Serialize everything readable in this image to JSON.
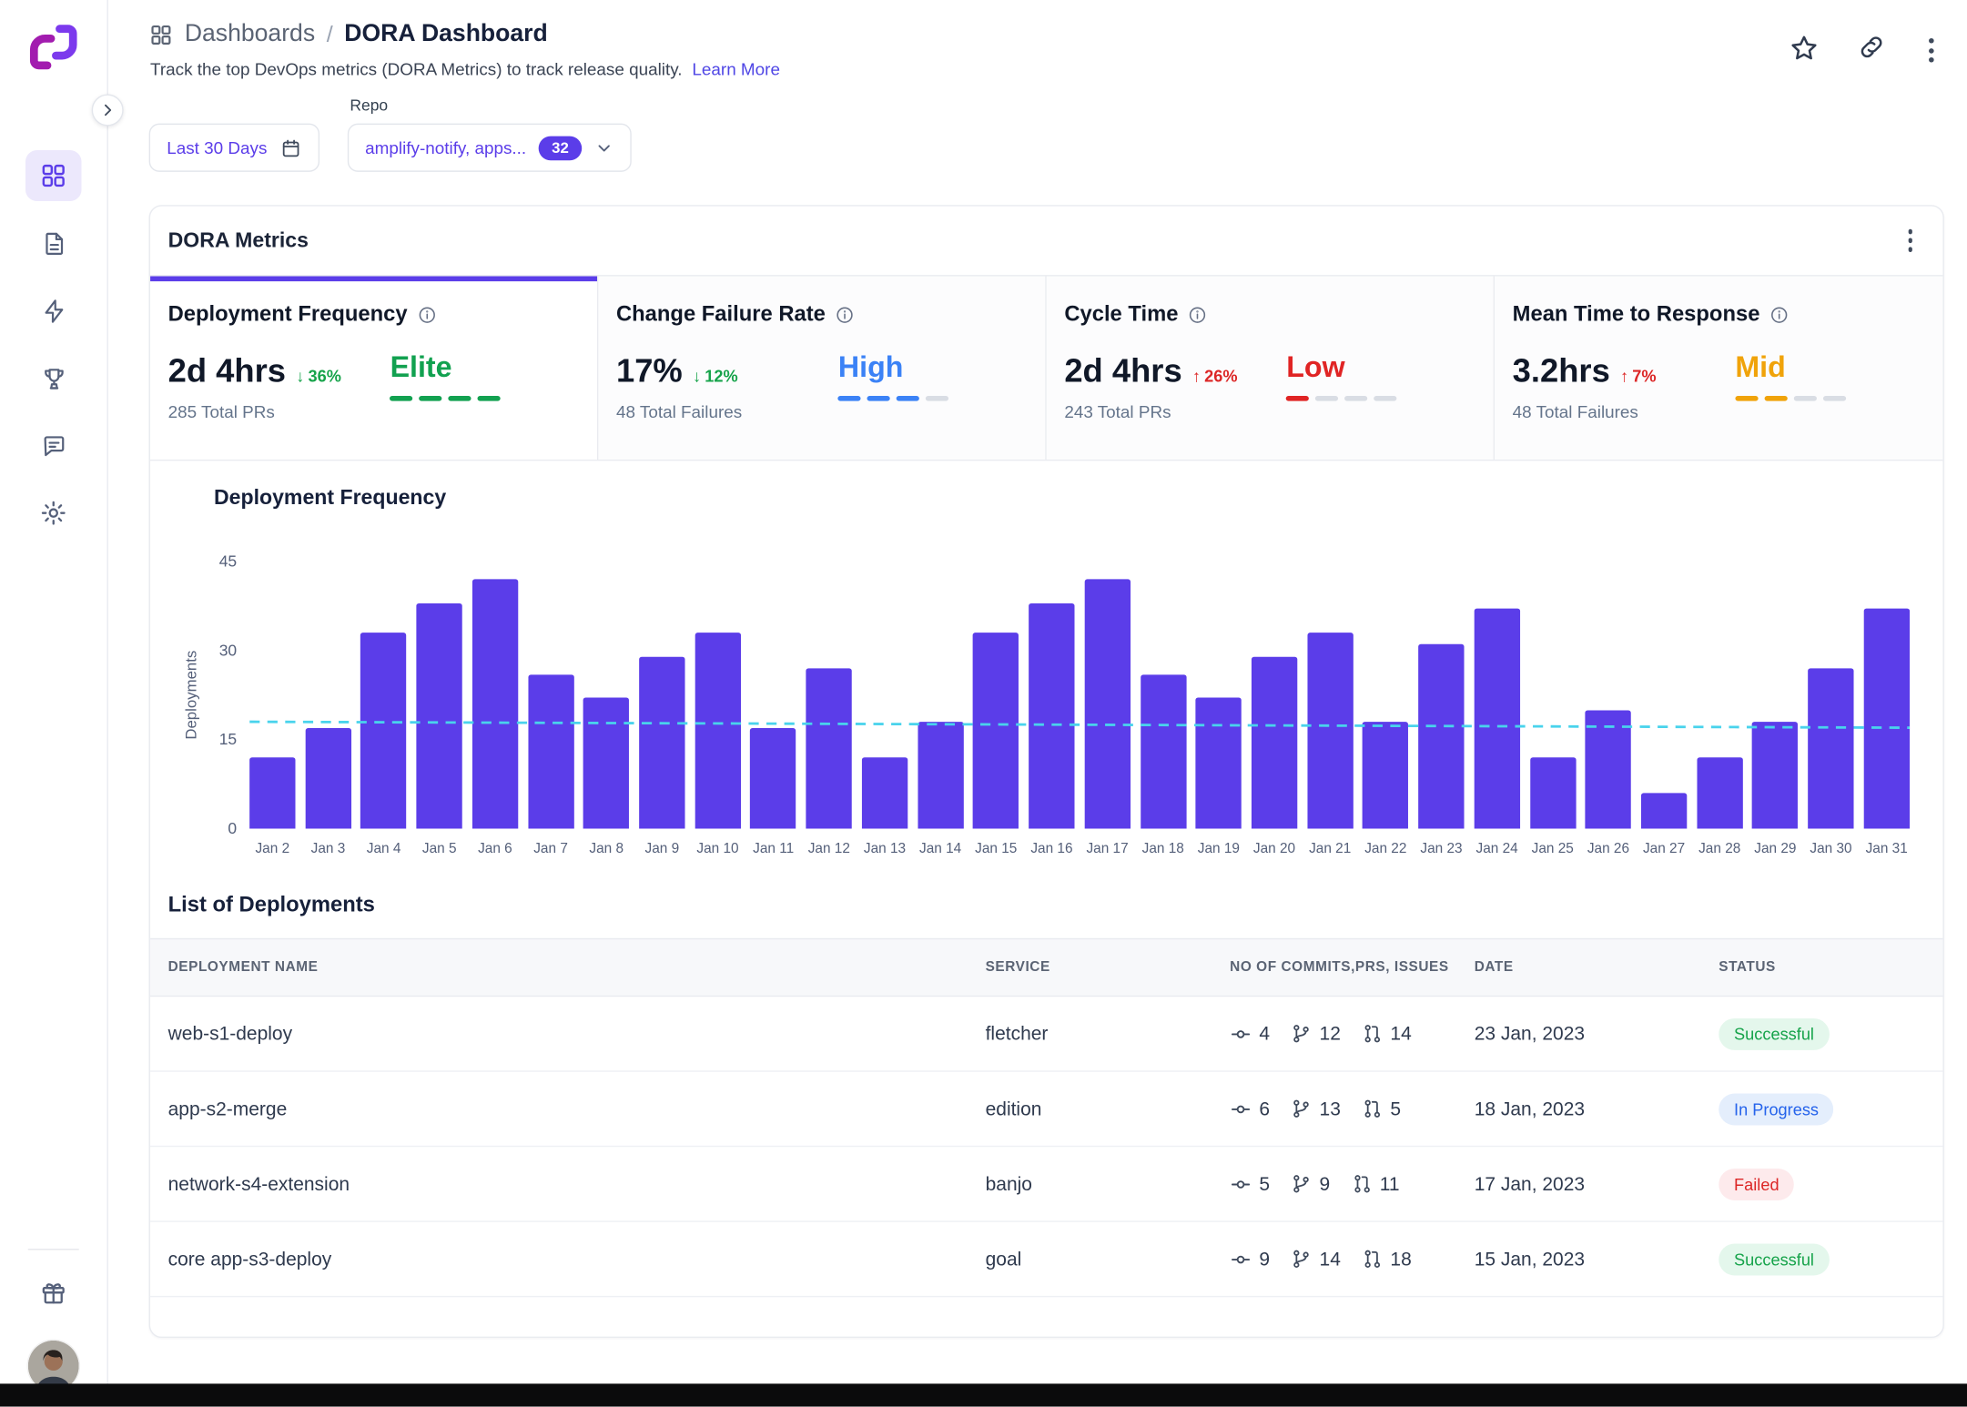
{
  "colors": {
    "accent": "#5b3de9",
    "bar": "#5b3de9",
    "trend": "#49d3ec",
    "elite_green": "#12a150",
    "high_blue": "#3b82f6",
    "low_red": "#e02424",
    "mid_amber": "#f0a30a",
    "delta_up_red": "#dc2626",
    "delta_down_green": "#16a34a"
  },
  "sidebar": {
    "items": [
      {
        "name": "dashboards",
        "active": true
      },
      {
        "name": "reports",
        "active": false
      },
      {
        "name": "automations",
        "active": false
      },
      {
        "name": "achievements",
        "active": false
      },
      {
        "name": "feedback",
        "active": false
      },
      {
        "name": "settings",
        "active": false
      }
    ]
  },
  "header": {
    "breadcrumb_root": "Dashboards",
    "breadcrumb_separator": "/",
    "breadcrumb_current": "DORA Dashboard",
    "subtitle": "Track the top DevOps metrics (DORA Metrics) to track release quality.",
    "learn_more_label": "Learn More"
  },
  "filters": {
    "date_range_label": "Last 30 Days",
    "repo_label": "Repo",
    "repo_value": "amplify-notify, apps...",
    "repo_count": "32"
  },
  "dora_card": {
    "title": "DORA Metrics",
    "tabs": [
      {
        "label": "Deployment Frequency",
        "value": "2d 4hrs",
        "delta_arrow": "↓",
        "delta": "36%",
        "sub": "285 Total PRs",
        "rating": "Elite"
      },
      {
        "label": "Change Failure Rate",
        "value": "17%",
        "delta_arrow": "↓",
        "delta": "12%",
        "sub": "48 Total Failures",
        "rating": "High"
      },
      {
        "label": "Cycle Time",
        "value": "2d 4hrs",
        "delta_arrow": "↑",
        "delta": "26%",
        "sub": "243 Total PRs",
        "rating": "Low"
      },
      {
        "label": "Mean Time to Response",
        "value": "3.2hrs",
        "delta_arrow": "↑",
        "delta": "7%",
        "sub": "48 Total Failures",
        "rating": "Mid"
      }
    ]
  },
  "chart": {
    "title": "Deployment Frequency",
    "ylabel": "Deployments",
    "yticks": [
      "45",
      "30",
      "15",
      "0"
    ]
  },
  "chart_data": {
    "type": "bar",
    "title": "Deployment Frequency",
    "xlabel": "",
    "ylabel": "Deployments",
    "ylim": [
      0,
      45
    ],
    "grid": false,
    "categories": [
      "Jan 2",
      "Jan 3",
      "Jan 4",
      "Jan 5",
      "Jan 6",
      "Jan 7",
      "Jan 8",
      "Jan 9",
      "Jan 10",
      "Jan 11",
      "Jan 12",
      "Jan 13",
      "Jan 14",
      "Jan 15",
      "Jan 16",
      "Jan 17",
      "Jan 18",
      "Jan 19",
      "Jan 20",
      "Jan 21",
      "Jan 22",
      "Jan 23",
      "Jan 24",
      "Jan 25",
      "Jan 26",
      "Jan 27",
      "Jan 28",
      "Jan 29",
      "Jan 30",
      "Jan 31"
    ],
    "values": [
      12,
      17,
      33,
      38,
      42,
      26,
      22,
      29,
      33,
      17,
      27,
      12,
      18,
      33,
      38,
      42,
      26,
      22,
      29,
      33,
      18,
      31,
      37,
      12,
      20,
      6,
      12,
      18,
      27,
      37
    ],
    "trend_line": {
      "style": "dashed",
      "start": 18,
      "end": 17
    }
  },
  "deployments": {
    "title": "List of Deployments",
    "columns": [
      "DEPLOYMENT NAME",
      "SERVICE",
      "NO OF COMMITS,PRS, ISSUES",
      "DATE",
      "STATUS"
    ],
    "rows": [
      {
        "name": "web-s1-deploy",
        "service": "fletcher",
        "commits": "4",
        "prs": "12",
        "issues": "14",
        "date": "23 Jan, 2023",
        "status": "Successful",
        "status_type": "success"
      },
      {
        "name": "app-s2-merge",
        "service": "edition",
        "commits": "6",
        "prs": "13",
        "issues": "5",
        "date": "18 Jan, 2023",
        "status": "In Progress",
        "status_type": "progress"
      },
      {
        "name": "network-s4-extension",
        "service": "banjo",
        "commits": "5",
        "prs": "9",
        "issues": "11",
        "date": "17 Jan, 2023",
        "status": "Failed",
        "status_type": "failed"
      },
      {
        "name": "core app-s3-deploy",
        "service": "goal",
        "commits": "9",
        "prs": "14",
        "issues": "18",
        "date": "15 Jan, 2023",
        "status": "Successful",
        "status_type": "success"
      }
    ]
  }
}
